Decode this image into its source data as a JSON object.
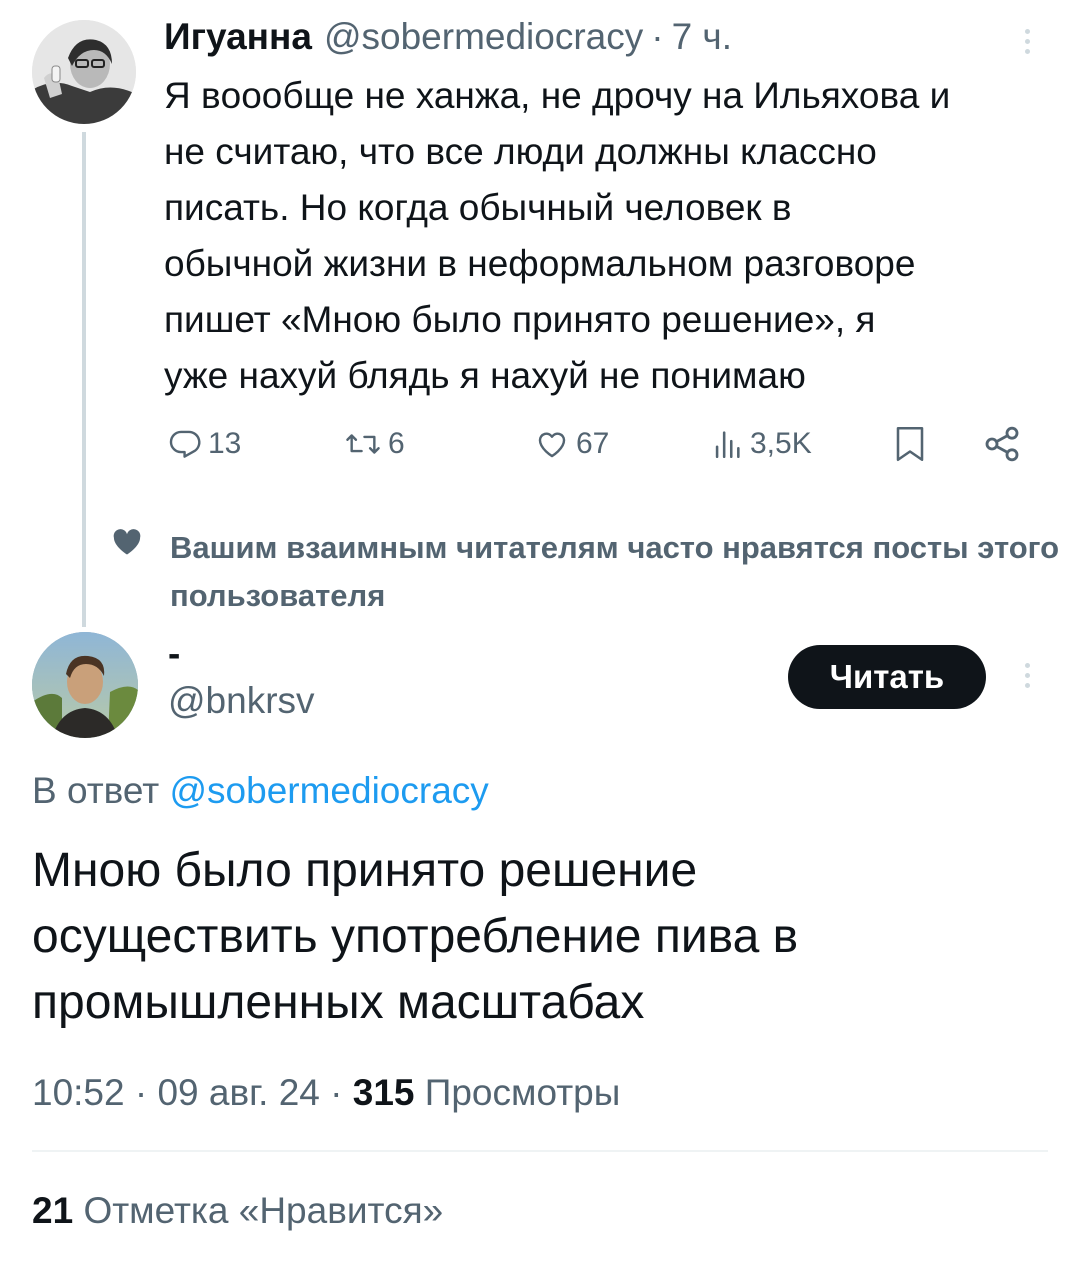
{
  "parent_tweet": {
    "author_name": "Игуанна",
    "author_handle": "@sobermediocracy",
    "separator": "·",
    "time_ago": "7 ч.",
    "text": "Я вooобще не ханжа, не дрочу на Ильяхова и\nне считаю, что все люди должны классно\nписать. Но когда обычный человек в\nобычной жизни в неформальном разговоре\nпишет «Мною было принято решение», я\nуже нахуй блядь я нахуй не понимаю",
    "actions": {
      "replies": "13",
      "reposts": "6",
      "likes": "67",
      "views": "3,5K"
    },
    "icons": [
      "reply-icon",
      "repost-icon",
      "like-icon",
      "views-icon",
      "bookmark-icon",
      "share-icon",
      "more-icon"
    ]
  },
  "social_context": {
    "text": "Вашим взаимным читателям часто нравятся посты этого пользователя"
  },
  "main_tweet": {
    "author_name": "-",
    "author_handle": "@bnkrsv",
    "follow_label": "Читать",
    "reply_prefix": "В ответ",
    "reply_to_handle": "@sobermediocracy",
    "text": "Мною было принято решение\nосуществить употребление пива в\nпромышленных масштабах",
    "time": "10:52",
    "date": "09 авг. 24",
    "separator": "·",
    "views_count": "315",
    "views_label": "Просмотры",
    "likes_count": "21",
    "likes_label": "Отметка «Нравится»"
  },
  "colors": {
    "text_primary": "#0f1419",
    "text_secondary": "#536471",
    "accent": "#1d9bf0",
    "divider": "#eff3f4",
    "thread_line": "#cfd9de",
    "button_bg": "#0f1419"
  }
}
